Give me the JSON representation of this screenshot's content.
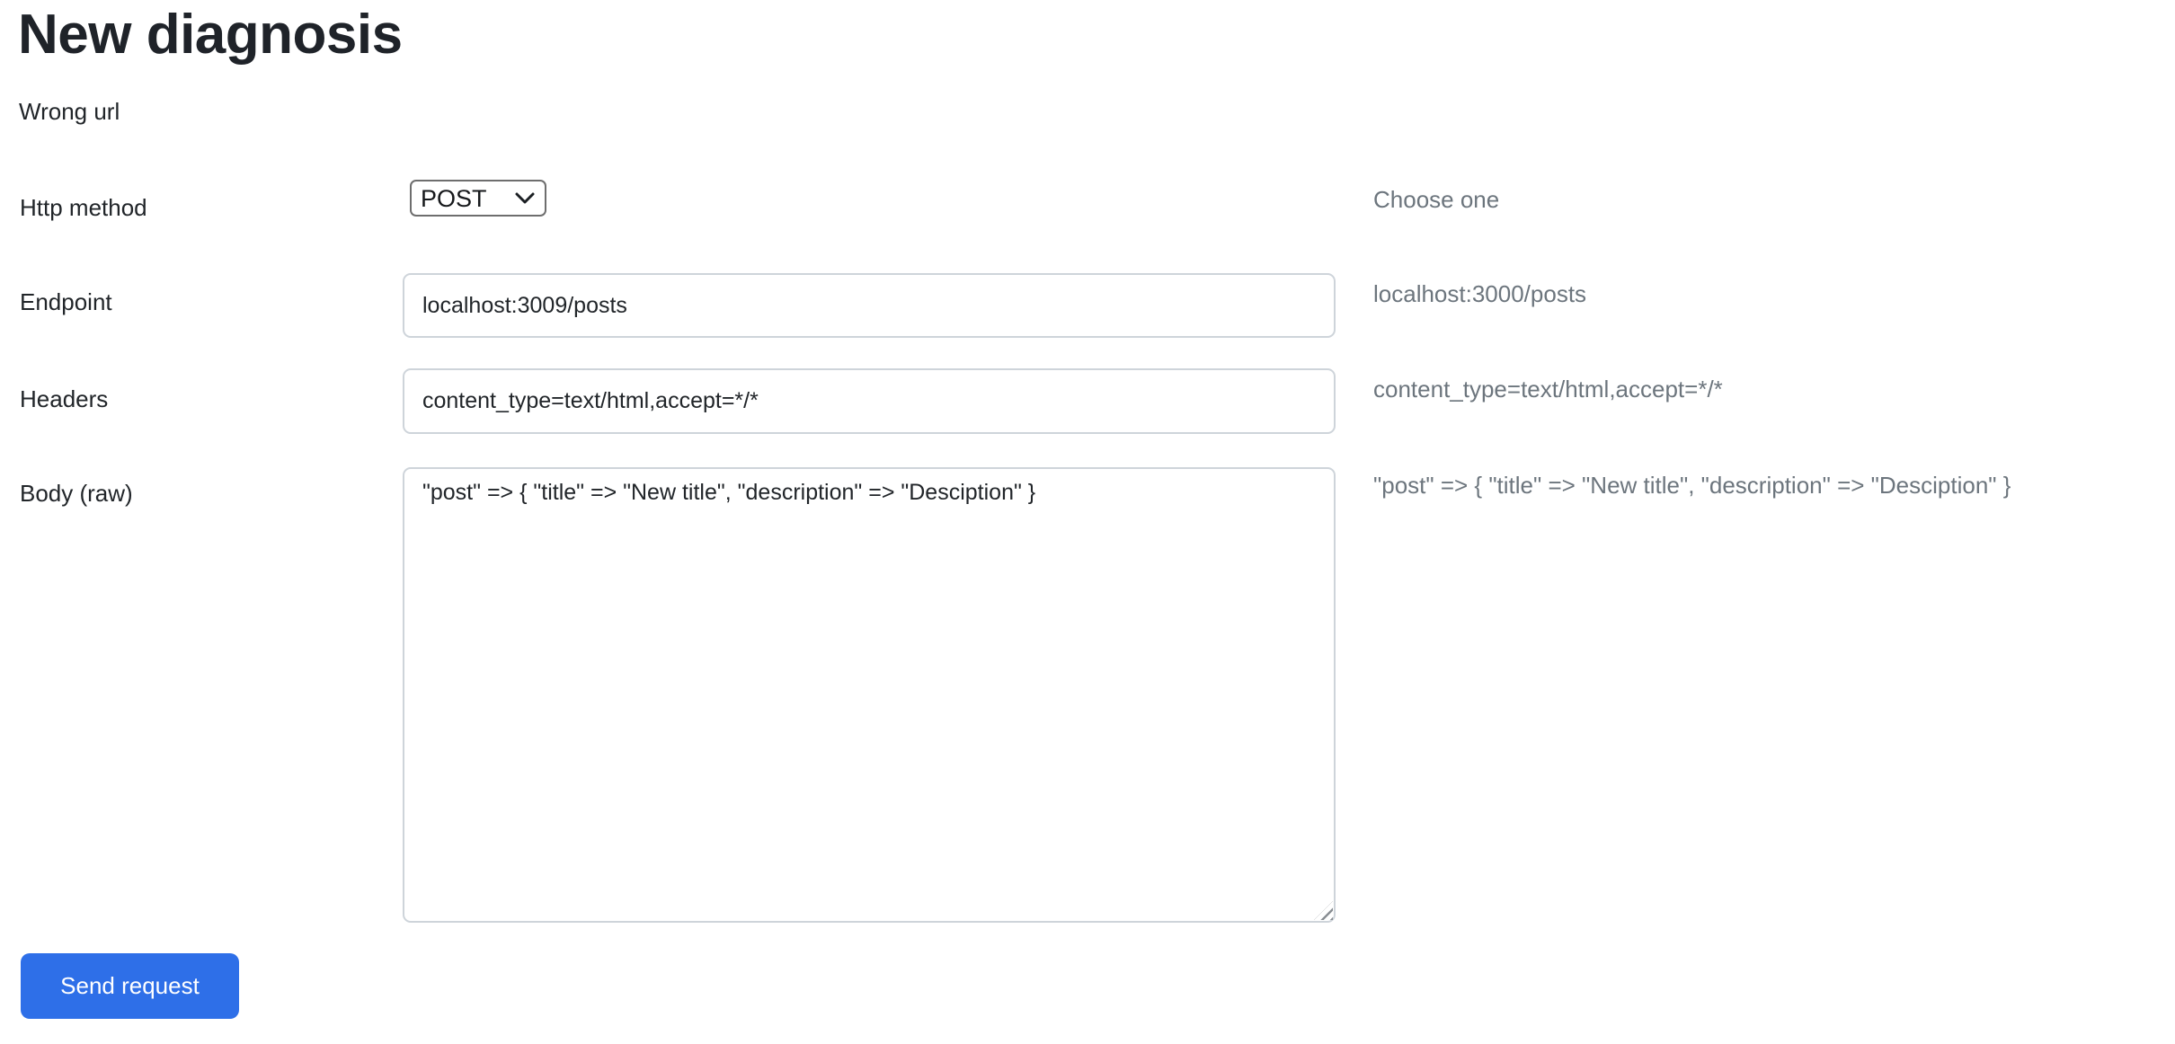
{
  "page": {
    "title": "New diagnosis",
    "subtitle": "Wrong url"
  },
  "form": {
    "http_method": {
      "label": "Http method",
      "value": "POST",
      "hint": "Choose one"
    },
    "endpoint": {
      "label": "Endpoint",
      "value": "localhost:3009/posts",
      "hint": "localhost:3000/posts"
    },
    "headers": {
      "label": "Headers",
      "value": "content_type=text/html,accept=*/*",
      "hint": "content_type=text/html,accept=*/*"
    },
    "body": {
      "label": "Body (raw)",
      "value": "\"post\" => { \"title\" => \"New title\", \"description\" => \"Desciption\" }",
      "hint": "\"post\" => { \"title\" => \"New title\", \"description\" => \"Desciption\" }"
    }
  },
  "actions": {
    "send_label": "Send request"
  },
  "colors": {
    "accent": "#2e6fe8",
    "text": "#212529",
    "hint_text": "#6c757d",
    "input_border": "#ced4da",
    "select_border": "#6e6e6e"
  },
  "icons": {
    "chevron_down": "chevron-down",
    "resize_grip": "resize-grip"
  }
}
